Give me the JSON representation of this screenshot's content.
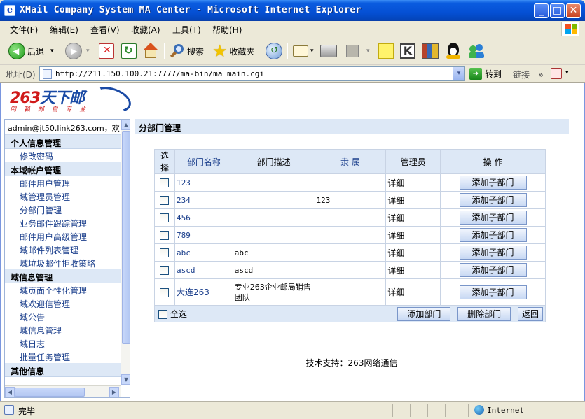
{
  "window": {
    "title": "XMail Company System MA Center - Microsoft Internet Explorer",
    "min_glyph": "_",
    "max_glyph": "□",
    "close_glyph": "✕"
  },
  "menubar": {
    "items": [
      "文件(F)",
      "编辑(E)",
      "查看(V)",
      "收藏(A)",
      "工具(T)",
      "帮助(H)"
    ]
  },
  "toolbar": {
    "back_label": "后退",
    "search_label": "搜索",
    "favorites_label": "收藏夹",
    "dropdown_glyph": "▾"
  },
  "addressbar": {
    "label": "地址(D)",
    "url": "http://211.150.100.21:7777/ma-bin/ma_main.cgi",
    "go_label": "转到",
    "links_label": "链接",
    "links_chevron": "»",
    "dropdown_glyph": "▾"
  },
  "logo": {
    "main": "263",
    "main_cn": "天下邮",
    "sub": "倒 赖 邮 自 专 业"
  },
  "sidebar": {
    "account": "admin@jt50.link263.com，欢",
    "groups": [
      {
        "title": "个人信息管理",
        "items": [
          "修改密码"
        ]
      },
      {
        "title": "本域帐户管理",
        "items": [
          "邮件用户管理",
          "域管理员管理",
          "分部门管理",
          "业务邮件跟踪管理",
          "邮件用户高级管理",
          "域邮件列表管理",
          "域垃圾邮件拒收策略"
        ]
      },
      {
        "title": "域信息管理",
        "items": [
          "域页面个性化管理",
          "域欢迎信管理",
          "域公告",
          "域信息管理",
          "域日志",
          "批量任务管理"
        ]
      },
      {
        "title": "其他信息",
        "items": []
      }
    ],
    "scroll": {
      "up": "▲",
      "down": "▼",
      "left": "◀",
      "right": "▶"
    }
  },
  "main": {
    "title": "分部门管理",
    "table": {
      "headers": [
        "选择",
        "部门名称",
        "部门描述",
        "隶 属",
        "管理员",
        "操 作"
      ],
      "rows": [
        {
          "name": "123",
          "desc": "",
          "parent": "",
          "admin": "详细",
          "action": "添加子部门"
        },
        {
          "name": "234",
          "desc": "",
          "parent": "123",
          "admin": "详细",
          "action": "添加子部门"
        },
        {
          "name": "456",
          "desc": "",
          "parent": "",
          "admin": "详细",
          "action": "添加子部门"
        },
        {
          "name": "789",
          "desc": "",
          "parent": "",
          "admin": "详细",
          "action": "添加子部门"
        },
        {
          "name": "abc",
          "desc": "abc",
          "parent": "",
          "admin": "详细",
          "action": "添加子部门"
        },
        {
          "name": "ascd",
          "desc": "ascd",
          "parent": "",
          "admin": "详细",
          "action": "添加子部门"
        },
        {
          "name": "大连263",
          "desc": "专业263企业邮局销售团队",
          "parent": "",
          "admin": "详细",
          "action": "添加子部门"
        }
      ],
      "select_all": "全选",
      "add_button": "添加部门",
      "delete_button": "删除部门",
      "back_button": "返回"
    },
    "footer": "技术支持：263网络通信"
  },
  "statusbar": {
    "status": "完毕",
    "zone": "Internet"
  },
  "colors": {
    "title_blue": "#0550d4",
    "link_blue": "#1b3f8c",
    "header_bg": "#dde8f6",
    "logo_red": "#d01a1a"
  }
}
